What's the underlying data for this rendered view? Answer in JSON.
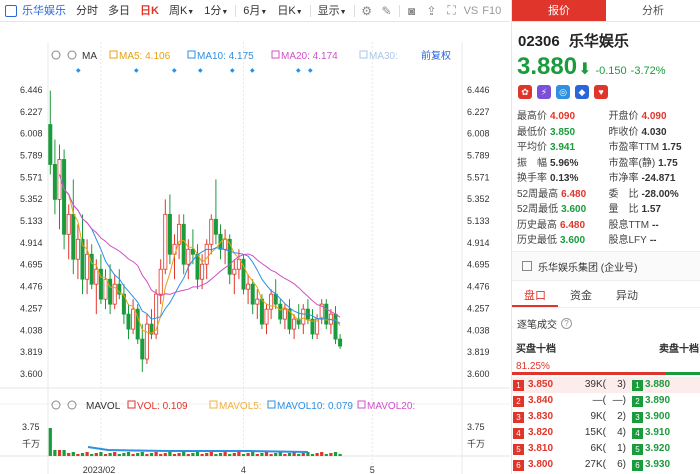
{
  "toolbar": {
    "stock_name": "乐华娱乐",
    "items": [
      "分时",
      "多日",
      "日K",
      "周K",
      "1分",
      "6月",
      "日K",
      "显示"
    ],
    "active_index": 2,
    "vs_label": "VS",
    "f10_label": "F10"
  },
  "chart_data": {
    "type": "candlestick",
    "main_label": "MA",
    "ma": [
      {
        "name": "MA5",
        "value": "4.106",
        "color": "#e8a010"
      },
      {
        "name": "MA10",
        "value": "4.175",
        "color": "#2f8fe0"
      },
      {
        "name": "MA20",
        "value": "4.174",
        "color": "#d050c8"
      },
      {
        "name": "MA30",
        "value": "",
        "color": "#a9c7e8"
      }
    ],
    "adjust_label": "前复权",
    "yticks": [
      "6.446",
      "6.227",
      "6.008",
      "5.789",
      "5.571",
      "5.352",
      "5.133",
      "4.914",
      "4.695",
      "4.476",
      "4.257",
      "4.038",
      "3.819",
      "3.600"
    ],
    "ylim": [
      3.6,
      6.446
    ],
    "xticks": [
      {
        "label": "2023/02",
        "index": 11
      },
      {
        "label": "4",
        "index": 42
      },
      {
        "label": "5",
        "index": 70
      }
    ],
    "n_slots": 90,
    "candles": [
      [
        6.1,
        6.44,
        5.6,
        5.7
      ],
      [
        5.7,
        5.95,
        5.2,
        5.35
      ],
      [
        5.35,
        5.9,
        5.05,
        5.75
      ],
      [
        5.75,
        5.85,
        4.85,
        5.0
      ],
      [
        5.0,
        5.3,
        4.75,
        5.2
      ],
      [
        5.2,
        5.55,
        4.6,
        4.75
      ],
      [
        4.75,
        5.1,
        4.55,
        4.95
      ],
      [
        4.95,
        5.2,
        4.4,
        4.55
      ],
      [
        4.55,
        4.95,
        4.4,
        4.8
      ],
      [
        4.8,
        4.9,
        4.45,
        4.5
      ],
      [
        4.5,
        4.75,
        4.2,
        4.65
      ],
      [
        4.65,
        4.8,
        4.3,
        4.35
      ],
      [
        4.35,
        4.65,
        4.25,
        4.55
      ],
      [
        4.55,
        4.7,
        4.2,
        4.3
      ],
      [
        4.3,
        4.6,
        4.25,
        4.5
      ],
      [
        4.5,
        4.65,
        4.35,
        4.4
      ],
      [
        4.4,
        4.5,
        4.1,
        4.2
      ],
      [
        4.2,
        4.3,
        3.95,
        4.05
      ],
      [
        4.05,
        4.35,
        4.0,
        4.25
      ],
      [
        4.25,
        4.3,
        3.9,
        3.95
      ],
      [
        3.95,
        4.1,
        3.62,
        3.75
      ],
      [
        3.75,
        4.2,
        3.7,
        4.1
      ],
      [
        4.1,
        4.25,
        3.95,
        4.0
      ],
      [
        4.0,
        4.45,
        3.95,
        4.4
      ],
      [
        4.4,
        4.75,
        4.3,
        4.65
      ],
      [
        4.65,
        5.35,
        4.6,
        5.2
      ],
      [
        5.2,
        5.4,
        4.7,
        4.8
      ],
      [
        4.8,
        5.0,
        4.55,
        4.9
      ],
      [
        4.9,
        5.2,
        4.75,
        5.1
      ],
      [
        5.1,
        5.2,
        4.6,
        4.7
      ],
      [
        4.7,
        4.95,
        4.55,
        4.85
      ],
      [
        4.85,
        5.05,
        4.7,
        4.8
      ],
      [
        4.8,
        4.9,
        4.45,
        4.55
      ],
      [
        4.55,
        4.8,
        4.45,
        4.7
      ],
      [
        4.7,
        4.95,
        4.55,
        4.9
      ],
      [
        4.9,
        5.2,
        4.8,
        5.15
      ],
      [
        5.15,
        5.55,
        4.9,
        5.0
      ],
      [
        5.0,
        5.1,
        4.75,
        4.85
      ],
      [
        4.85,
        5.05,
        4.7,
        4.95
      ],
      [
        4.95,
        5.0,
        4.5,
        4.6
      ],
      [
        4.6,
        4.75,
        4.4,
        4.65
      ],
      [
        4.65,
        4.85,
        4.55,
        4.75
      ],
      [
        4.75,
        4.8,
        4.4,
        4.45
      ],
      [
        4.45,
        4.6,
        4.3,
        4.5
      ],
      [
        4.5,
        4.55,
        4.2,
        4.3
      ],
      [
        4.3,
        4.45,
        4.15,
        4.35
      ],
      [
        4.35,
        4.4,
        4.05,
        4.1
      ],
      [
        4.1,
        4.3,
        4.0,
        4.25
      ],
      [
        4.25,
        4.45,
        4.15,
        4.4
      ],
      [
        4.4,
        4.55,
        4.25,
        4.3
      ],
      [
        4.3,
        4.35,
        4.1,
        4.15
      ],
      [
        4.15,
        4.3,
        4.05,
        4.25
      ],
      [
        4.25,
        4.35,
        4.0,
        4.05
      ],
      [
        4.05,
        4.2,
        3.95,
        4.15
      ],
      [
        4.15,
        4.3,
        4.05,
        4.1
      ],
      [
        4.1,
        4.3,
        4.0,
        4.25
      ],
      [
        4.25,
        4.35,
        4.1,
        4.15
      ],
      [
        4.15,
        4.25,
        3.95,
        4.0
      ],
      [
        4.0,
        4.2,
        3.95,
        4.15
      ],
      [
        4.15,
        4.35,
        4.1,
        4.3
      ],
      [
        4.3,
        4.35,
        4.05,
        4.1
      ],
      [
        4.1,
        4.25,
        4.0,
        4.2
      ],
      [
        4.2,
        4.28,
        3.9,
        3.95
      ],
      [
        3.95,
        4.0,
        3.85,
        3.88
      ]
    ],
    "vol_panel": {
      "label": "MAVOL",
      "items": [
        {
          "name": "VOL",
          "value": "0.109",
          "color": "#e0352b"
        },
        {
          "name": "MAVOL5",
          "value": "",
          "color": "#f0b040"
        },
        {
          "name": "MAVOL10",
          "value": "0.079",
          "color": "#2f8fe0"
        },
        {
          "name": "MAVOL20",
          "value": "",
          "color": "#d050c8"
        }
      ],
      "yticks": [
        "3.75",
        "千万"
      ]
    }
  },
  "right": {
    "tabs": [
      "报价",
      "分析"
    ],
    "code": "02306",
    "name": "乐华娱乐",
    "price": "3.880",
    "change": "-0.150",
    "change_pct": "-3.72%",
    "stats": [
      [
        {
          "k": "最高价",
          "v": "4.090",
          "c": "red"
        },
        {
          "k": "开盘价",
          "v": "4.090",
          "c": "red"
        }
      ],
      [
        {
          "k": "最低价",
          "v": "3.850",
          "c": "green"
        },
        {
          "k": "昨收价",
          "v": "4.030",
          "c": "dark"
        }
      ],
      [
        {
          "k": "平均价",
          "v": "3.941",
          "c": "green"
        },
        {
          "k": "市盈率TTM",
          "v": "1.75",
          "c": "dark"
        }
      ],
      [
        {
          "k": "振　幅",
          "v": "5.96%",
          "c": "dark"
        },
        {
          "k": "市盈率(静)",
          "v": "1.75",
          "c": "dark"
        }
      ],
      [
        {
          "k": "换手率",
          "v": "0.13%",
          "c": "dark"
        },
        {
          "k": "市净率",
          "v": "-24.871",
          "c": "dark"
        }
      ],
      [
        {
          "k": "52周最高",
          "v": "6.480",
          "c": "red"
        },
        {
          "k": "委　比",
          "v": "-28.00%",
          "c": "dark"
        }
      ],
      [
        {
          "k": "52周最低",
          "v": "3.600",
          "c": "green"
        },
        {
          "k": "量　比",
          "v": "1.57",
          "c": "dark"
        }
      ],
      [
        {
          "k": "历史最高",
          "v": "6.480",
          "c": "red"
        },
        {
          "k": "股息TTM",
          "v": "--",
          "c": "dark"
        }
      ],
      [
        {
          "k": "历史最低",
          "v": "3.600",
          "c": "green"
        },
        {
          "k": "股息LFY",
          "v": "--",
          "c": "dark"
        }
      ]
    ],
    "company": "乐华娱乐集团 (企业号)",
    "subtabs": [
      "盘口",
      "资金",
      "异动"
    ],
    "zhubi": "逐笔成交",
    "buy10": "买盘十档",
    "sell10": "卖盘十档",
    "buy_ratio": "81.25%",
    "book": [
      {
        "n": "1",
        "bp": "3.850",
        "bv": "39K(",
        "bc": "3)",
        "sn": "1",
        "sp": "3.880"
      },
      {
        "n": "2",
        "bp": "3.840",
        "bv": "—(",
        "bc": "—)",
        "sn": "2",
        "sp": "3.890"
      },
      {
        "n": "3",
        "bp": "3.830",
        "bv": "9K(",
        "bc": "2)",
        "sn": "3",
        "sp": "3.900"
      },
      {
        "n": "4",
        "bp": "3.820",
        "bv": "15K(",
        "bc": "4)",
        "sn": "4",
        "sp": "3.910"
      },
      {
        "n": "5",
        "bp": "3.810",
        "bv": "6K(",
        "bc": "1)",
        "sn": "5",
        "sp": "3.920"
      },
      {
        "n": "6",
        "bp": "3.800",
        "bv": "27K(",
        "bc": "6)",
        "sn": "6",
        "sp": "3.930"
      }
    ]
  }
}
